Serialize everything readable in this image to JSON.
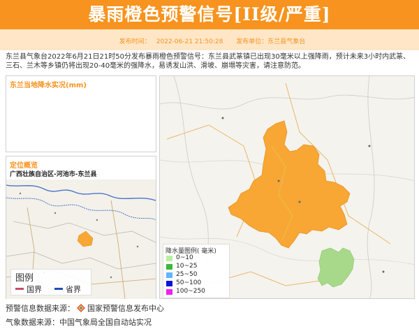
{
  "header": {
    "title": "暴雨橙色预警信号[II级/严重]",
    "publish_time_label": "发布时间：",
    "publish_time": "2022-06-21 21:50:28",
    "publisher_label": "发布单位：",
    "publisher": "东兰县气象台"
  },
  "description": "东兰县气象台2022年6月21日21时50分发布暴雨橙色预警信号：东兰县武篆镇已出现30毫米以上强降雨，预计未来3小时内武篆、三石、兰木等乡镇仍将出现20-40毫米的强降水，易诱发山洪、滑坡、崩塌等灾害，请注意防范。",
  "rain_panel": {
    "title": "东兰当地降水实况(mm)"
  },
  "location_panel": {
    "title": "定位概览",
    "region": "广西壮族自治区-河池市-东兰县",
    "legend_title": "图例",
    "legend_items": [
      {
        "label": "国界",
        "color": "#c0506a"
      },
      {
        "label": "省界",
        "color": "#1f4fb8"
      }
    ]
  },
  "rain_legend": {
    "title": "降水量图例( 毫米)",
    "items": [
      {
        "label": "0~10",
        "color": "#b8f0a0"
      },
      {
        "label": "10~25",
        "color": "#3cb83c"
      },
      {
        "label": "25~50",
        "color": "#5fb6ff"
      },
      {
        "label": "50~100",
        "color": "#0a14d8"
      },
      {
        "label": "100~250",
        "color": "#ee22ee"
      }
    ]
  },
  "footer": {
    "source1_label": "预警信息数据来源：",
    "source1": "国家预警信息发布中心",
    "source2_label": "气象数据来源：",
    "source2": "中国气象局全国自动站实况"
  },
  "colors": {
    "brand_orange": "#f7931e",
    "warning_area": "#f8a735",
    "neighbor_area": "#a8d98a"
  }
}
